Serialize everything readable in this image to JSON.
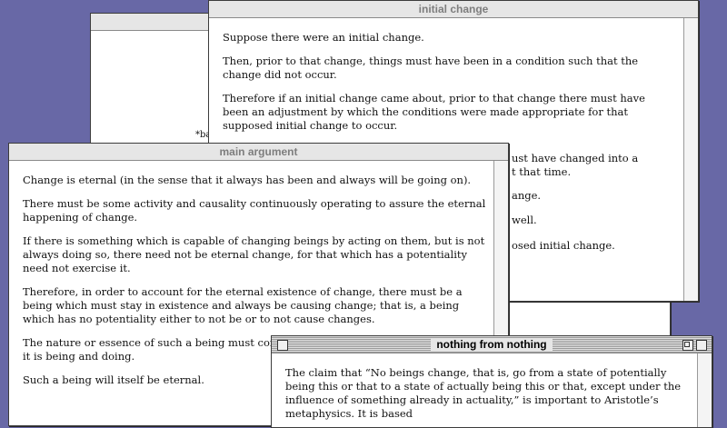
{
  "windows": {
    "back": {
      "fragment": "*ba"
    },
    "initial_change": {
      "title": "initial change",
      "paragraphs": [
        "Suppose there were an initial change.",
        "Then, prior to that change, things must have been in a condition such that the change did not occur.",
        "Therefore if an initial change came about, prior to that change there must have been an adjustment by which the conditions were made appropriate for that supposed initial change to occur."
      ],
      "partial_lines": [
        "ust have changed into a",
        "t that time.",
        "ange.",
        "well.",
        "osed initial change."
      ]
    },
    "main_argument": {
      "title": "main argument",
      "paragraphs": [
        "Change is eternal (in the sense that it always has been and always will be going on).",
        "There must be some activity and causality continuously operating to assure the eternal happening of change.",
        "If there is something which is capable of changing beings by acting on them, but is not  always doing so, there need not be eternal change, for that which has a potentiality need not exercise it.",
        "Therefore, in order to account for the eternal existence of change, there must be a being which must stay in existence and always be causing change; that is, a being which has no potentiality either to not be or to not cause changes.",
        "The nature or essence of such a being must contai",
        "it is being and doing.",
        "Such a being will itself be eternal."
      ]
    },
    "nothing_from_nothing": {
      "title": "nothing from nothing",
      "paragraphs": [
        "The claim that “No beings change, that is, go from a state of potentially being this or that to a state of actually being this or that, except under the influence of something already in actuality,” is important to Aristotle’s metaphysics. It is based"
      ]
    }
  },
  "colors": {
    "desktop": "#6868a6",
    "window": "#ffffff",
    "titlebar": "#e6e6e6"
  }
}
